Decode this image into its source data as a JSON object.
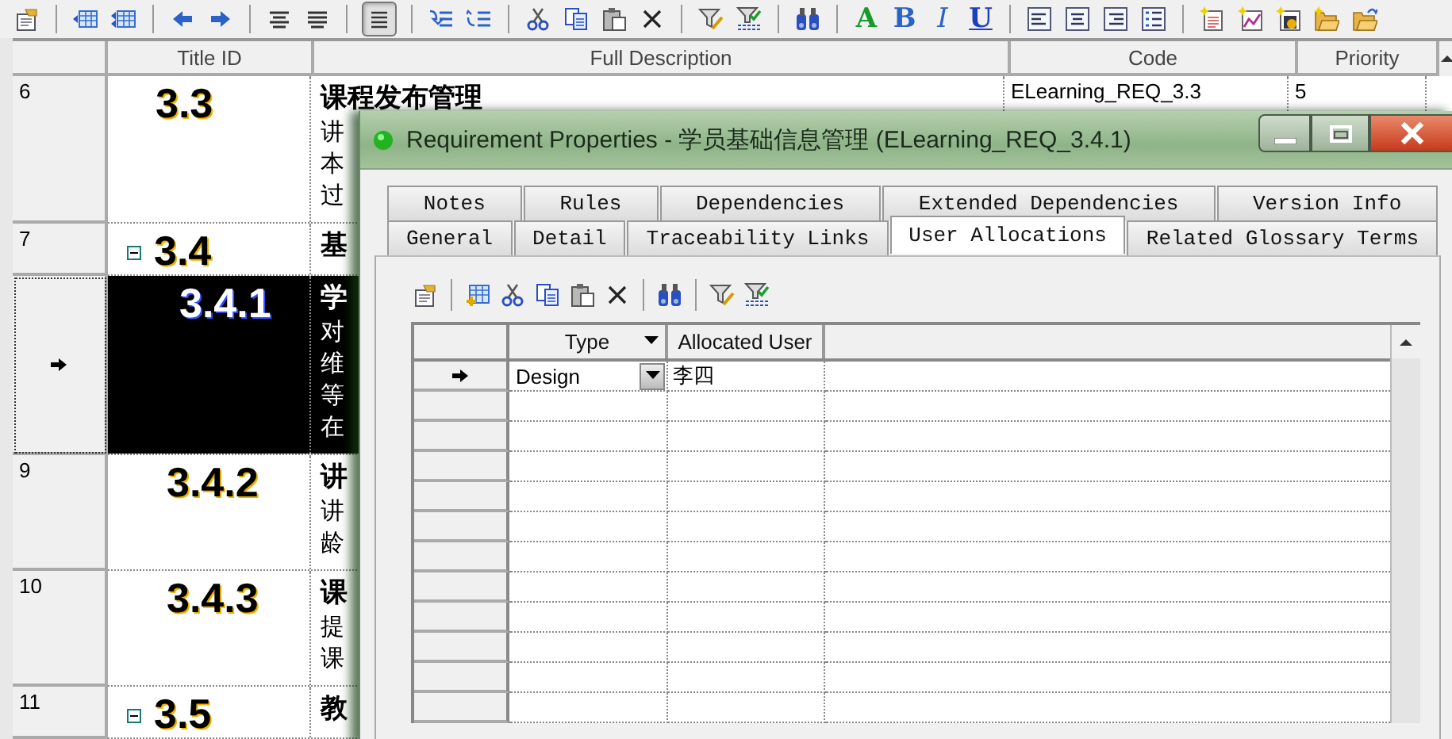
{
  "toolbar": {
    "groups": [
      [
        {
          "pressed": false
        }
      ],
      [
        {
          "pressed": false
        },
        {
          "pressed": false
        }
      ],
      [
        {
          "pressed": false
        },
        {
          "pressed": false
        }
      ],
      [
        {
          "pressed": false
        },
        {
          "pressed": false
        }
      ],
      [
        {
          "pressed": true
        }
      ],
      [
        {
          "pressed": false
        },
        {
          "pressed": false
        }
      ],
      [
        {
          "pressed": false
        },
        {
          "pressed": false
        },
        {
          "pressed": false
        },
        {
          "pressed": false
        }
      ],
      [
        {
          "pressed": false
        },
        {
          "pressed": false
        }
      ],
      [
        {
          "pressed": false
        }
      ],
      [
        {
          "pressed": false,
          "kind": "color",
          "label": "A"
        },
        {
          "pressed": false,
          "kind": "bold",
          "label": "B"
        },
        {
          "pressed": false,
          "kind": "italic",
          "label": "I"
        },
        {
          "pressed": false,
          "kind": "underline",
          "label": "U"
        }
      ],
      [
        {
          "pressed": false
        },
        {
          "pressed": false
        },
        {
          "pressed": false
        },
        {
          "pressed": false
        }
      ],
      [
        {
          "pressed": false
        },
        {
          "pressed": false
        },
        {
          "pressed": false
        },
        {
          "pressed": false
        },
        {
          "pressed": false
        }
      ]
    ]
  },
  "table": {
    "columns": [
      "Title ID",
      "Full Description",
      "Code",
      "Priority"
    ],
    "rows": [
      {
        "number": "6",
        "kind": "leaf",
        "title_id": "3.3",
        "heading": "课程发布管理",
        "lines": [
          "讲",
          "本",
          "过"
        ],
        "code": "ELearning_REQ_3.3",
        "priority": "5",
        "selected": false
      },
      {
        "number": "7",
        "kind": "group",
        "expanded": true,
        "title_id": "3.4",
        "heading": "基",
        "lines": [],
        "selected": false,
        "children": [
          {
            "kind": "leaf",
            "title_id": "3.4.1",
            "heading": "学",
            "lines": [
              "对",
              "维",
              "等",
              "在"
            ],
            "selected": true
          },
          {
            "number": "9",
            "kind": "leaf",
            "title_id": "3.4.2",
            "heading": "讲",
            "lines": [
              "讲",
              "龄"
            ],
            "selected": false
          },
          {
            "number": "10",
            "kind": "leaf",
            "title_id": "3.4.3",
            "heading": "课",
            "lines": [
              "提",
              "课"
            ],
            "selected": false
          }
        ]
      },
      {
        "number": "11",
        "kind": "group",
        "expanded": true,
        "title_id": "3.5",
        "heading": "教",
        "lines": [],
        "selected": false
      }
    ]
  },
  "dialog": {
    "title": "Requirement Properties - 学员基础信息管理 (ELearning_REQ_3.4.1)",
    "tab_rows": [
      [
        {
          "label": "Notes",
          "selected": false
        },
        {
          "label": "Rules",
          "selected": false
        },
        {
          "label": "Dependencies",
          "selected": false
        },
        {
          "label": "Extended Dependencies",
          "selected": false
        },
        {
          "label": "Version Info",
          "selected": false
        }
      ],
      [
        {
          "label": "General",
          "selected": false
        },
        {
          "label": "Detail",
          "selected": false
        },
        {
          "label": "Traceability Links",
          "selected": false
        },
        {
          "label": "User Allocations",
          "selected": true
        },
        {
          "label": "Related Glossary Terms",
          "selected": false
        }
      ]
    ],
    "grid": {
      "columns": [
        {
          "label": "Type",
          "filter": true
        },
        {
          "label": "Allocated User",
          "filter": false
        }
      ],
      "rows": [
        {
          "type": "Design",
          "user": "李四",
          "selected": true
        }
      ]
    }
  }
}
